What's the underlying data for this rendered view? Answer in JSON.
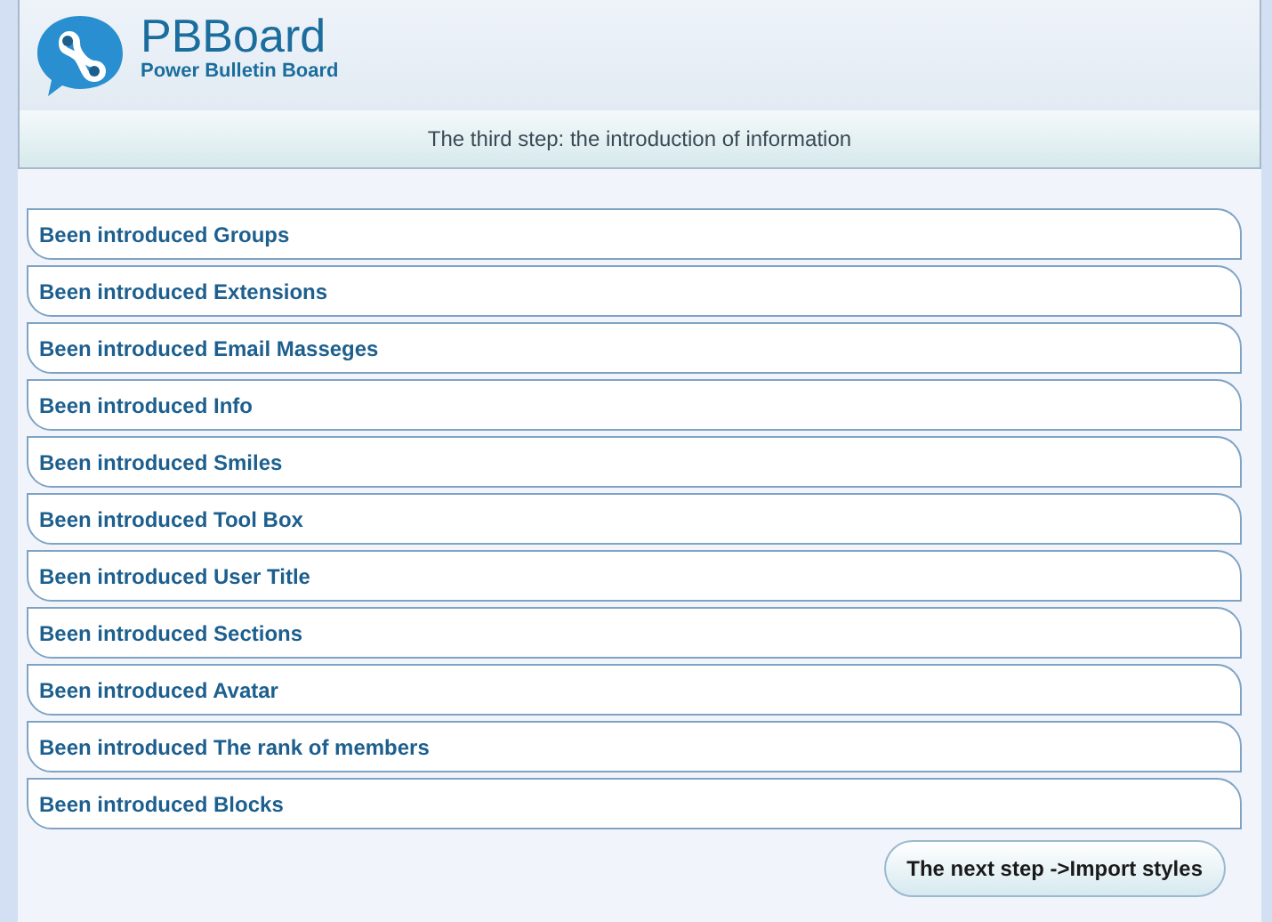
{
  "header": {
    "title": "PBBoard",
    "subtitle": "Power Bulletin Board"
  },
  "step_title": "The third step: the introduction of information",
  "items": [
    "Been introduced Groups",
    "Been introduced Extensions",
    "Been introduced Email Masseges",
    "Been introduced Info",
    "Been introduced Smiles",
    "Been introduced Tool Box",
    "Been introduced User Title",
    "Been introduced Sections",
    "Been introduced Avatar",
    "Been introduced The rank of members",
    "Been introduced Blocks"
  ],
  "next_button": "The next step ->Import styles"
}
